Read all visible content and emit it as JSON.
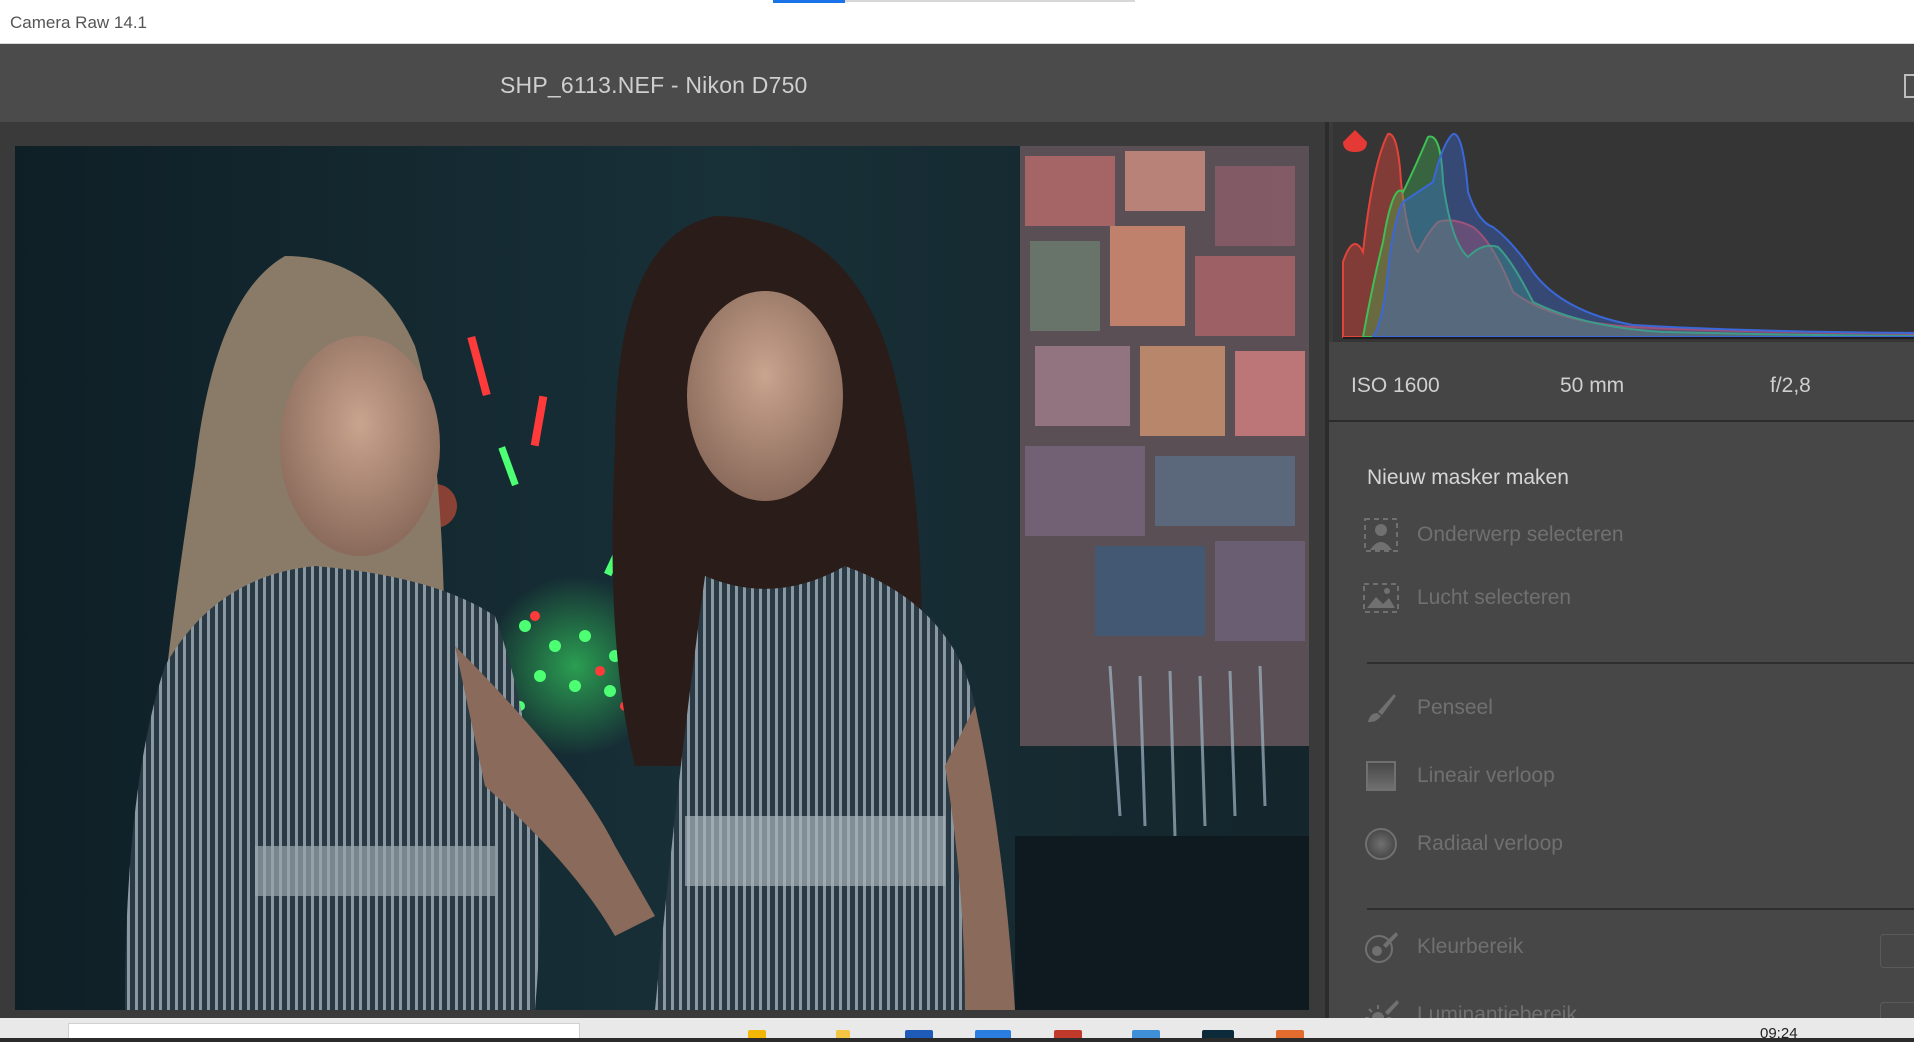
{
  "window": {
    "title": "Camera Raw 14.1"
  },
  "header": {
    "document": "SHP_6113.NEF  -  Nikon D750"
  },
  "exif": {
    "iso": "ISO 1600",
    "focal": "50 mm",
    "aperture": "f/2,8"
  },
  "masking": {
    "title": "Nieuw masker maken",
    "items": [
      {
        "label": "Onderwerp selecteren",
        "icon": "person-icon"
      },
      {
        "label": "Lucht selecteren",
        "icon": "sky-icon"
      },
      {
        "label": "Penseel",
        "icon": "brush-icon"
      },
      {
        "label": "Lineair verloop",
        "icon": "linear-gradient-icon"
      },
      {
        "label": "Radiaal verloop",
        "icon": "radial-gradient-icon"
      },
      {
        "label": "Kleurbereik",
        "icon": "color-range-icon"
      },
      {
        "label": "Luminantiebereik",
        "icon": "luminance-range-icon"
      }
    ]
  },
  "taskbar": {
    "clock": "09:24"
  },
  "colors": {
    "accent": "#1a73e8",
    "histogram_red": "#e0443a",
    "histogram_green": "#3fbf55",
    "histogram_blue": "#3a68d8",
    "clipping_warning": "#e53935"
  }
}
